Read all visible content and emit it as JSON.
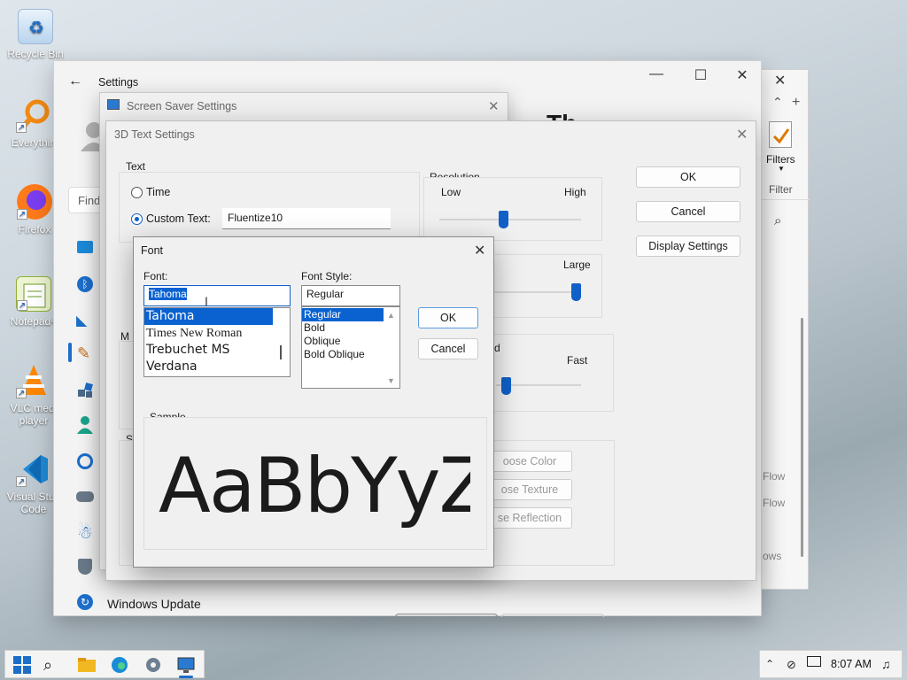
{
  "desktop": {
    "icons": [
      {
        "label": "Recycle Bin",
        "icon": "recycle-bin-icon"
      },
      {
        "label": "Everythin",
        "icon": "everything-search-icon"
      },
      {
        "label": "Firefox",
        "icon": "firefox-icon"
      },
      {
        "label": "Notepad+",
        "icon": "notepad-plus-plus-icon"
      },
      {
        "label": "VLC medi player",
        "icon": "vlc-icon"
      },
      {
        "label": "Visual Stud Code",
        "icon": "vscode-icon"
      }
    ]
  },
  "settings": {
    "title": "Settings",
    "search_placeholder": "Find",
    "heading_partial": "Th",
    "windows_update": "Windows Update",
    "min_glyph": "—",
    "max_glyph": "☐",
    "close_glyph": "✕",
    "back_glyph": "←"
  },
  "rightwin": {
    "filters_label": "Filters",
    "filter_label": "Filter",
    "flow1": "Flow",
    "flow2": "Flow",
    "ows": "ows"
  },
  "screensaver": {
    "title": "Screen Saver Settings"
  },
  "t3d": {
    "title": "3D Text Settings",
    "text_group": "Text",
    "time_label": "Time",
    "custom_label": "Custom Text:",
    "custom_value": "Fluentize10",
    "resolution": "Resolution",
    "low": "Low",
    "high": "High",
    "large": "Large",
    "fast": "Fast",
    "d_partial": "d",
    "m_partial": "M",
    "su_partial": "Su",
    "ok": "OK",
    "cancel": "Cancel",
    "display_settings": "Display Settings",
    "choose_color": "oose Color",
    "choose_texture": "ose Texture",
    "choose_reflection": "se Reflection"
  },
  "fontdlg": {
    "title": "Font",
    "font_label": "Font:",
    "font_value": "Tahoma",
    "font_list": [
      "Tahoma",
      "Times New Roman",
      "Trebuchet MS",
      "Verdana"
    ],
    "style_label": "Font Style:",
    "style_value": "Regular",
    "style_list": [
      "Regular",
      "Bold",
      "Oblique",
      "Bold Oblique"
    ],
    "ok": "OK",
    "cancel": "Cancel",
    "sample_label": "Sample",
    "sample_text": "AaBbYyZ"
  },
  "taskbar": {
    "time": "8:07 AM"
  },
  "colors": {
    "accent": "#1060c8",
    "selection": "#0a62d0"
  }
}
